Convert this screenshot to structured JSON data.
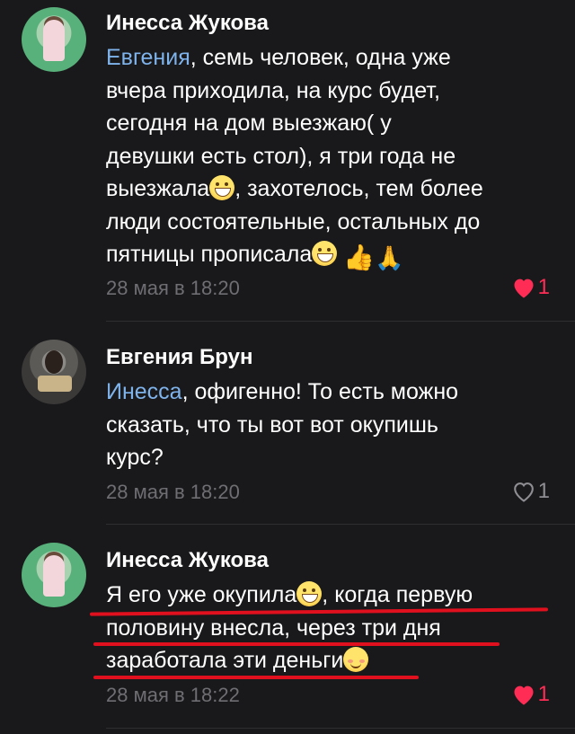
{
  "comments": [
    {
      "author": "Инесса Жукова",
      "mention": "Евгения",
      "text_lines": [
        ", семь человек, одна уже",
        "вчера приходила, на курс будет,",
        "сегодня на дом выезжаю( у",
        "девушки есть стол), я три года не",
        "выезжала",
        ", захотелось, тем более",
        "люди состоятельные, остальных до",
        "пятницы прописала"
      ],
      "time": "28 мая в 18:20",
      "likes": "1",
      "liked": true
    },
    {
      "author": "Евгения Брун",
      "mention": "Инесса",
      "text_lines": [
        ", офигенно! То есть можно",
        "сказать, что ты вот вот окупишь",
        "курс?"
      ],
      "time": "28 мая в 18:20",
      "likes": "1",
      "liked": false
    },
    {
      "author": "Инесса Жукова",
      "text_lines": [
        "Я его уже окупила",
        ", когда первую",
        "половину внесла, через три дня",
        "заработала эти деньги"
      ],
      "time": "28 мая в 18:22",
      "likes": "1",
      "liked": true
    }
  ],
  "colors": {
    "background": "#19191b",
    "mention": "#7fb3ec",
    "like_active": "#ff2d55",
    "muted": "#6e6e73",
    "underline": "#e0101e"
  },
  "icons": {
    "like": "heart-icon",
    "emoji_grin": "grinning-emoji-icon",
    "emoji_thumb": "thumbs-up-emoji-icon",
    "emoji_pray": "folded-hands-emoji-icon",
    "emoji_blush": "smiling-emoji-icon"
  }
}
